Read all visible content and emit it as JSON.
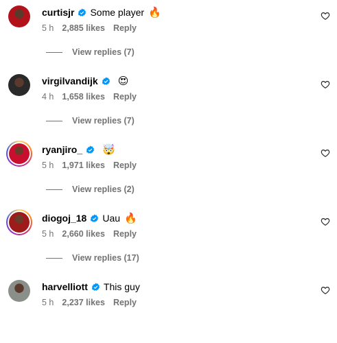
{
  "comments": [
    {
      "username": "curtisjr",
      "text": "Some player",
      "emoji": "🔥",
      "time": "5 h",
      "likes": "2,885 likes",
      "reply": "Reply",
      "view_replies": "View replies (7)",
      "ring": false,
      "avatar_color": "#b3121b"
    },
    {
      "username": "virgilvandijk",
      "text": "",
      "emoji": "😍",
      "time": "4 h",
      "likes": "1,658 likes",
      "reply": "Reply",
      "view_replies": "View replies (7)",
      "ring": false,
      "avatar_color": "#2a2a2a"
    },
    {
      "username": "ryanjiro_",
      "text": "",
      "emoji": "🤯",
      "time": "5 h",
      "likes": "1,971 likes",
      "reply": "Reply",
      "view_replies": "View replies (2)",
      "ring": true,
      "avatar_color": "#c8102e"
    },
    {
      "username": "diogoj_18",
      "text": "Uau",
      "emoji": "🔥",
      "time": "5 h",
      "likes": "2,660 likes",
      "reply": "Reply",
      "view_replies": "View replies (17)",
      "ring": true,
      "avatar_color": "#9e1b1b"
    },
    {
      "username": "harvelliott",
      "text": "This guy",
      "emoji": "",
      "time": "5 h",
      "likes": "2,237 likes",
      "reply": "Reply",
      "view_replies": "",
      "ring": false,
      "avatar_color": "#8a8f8a"
    }
  ],
  "colors": {
    "verified": "#0095f6",
    "secondary_text": "#737373"
  },
  "icons": {
    "verified": "verified-badge-icon",
    "like": "heart-icon"
  }
}
